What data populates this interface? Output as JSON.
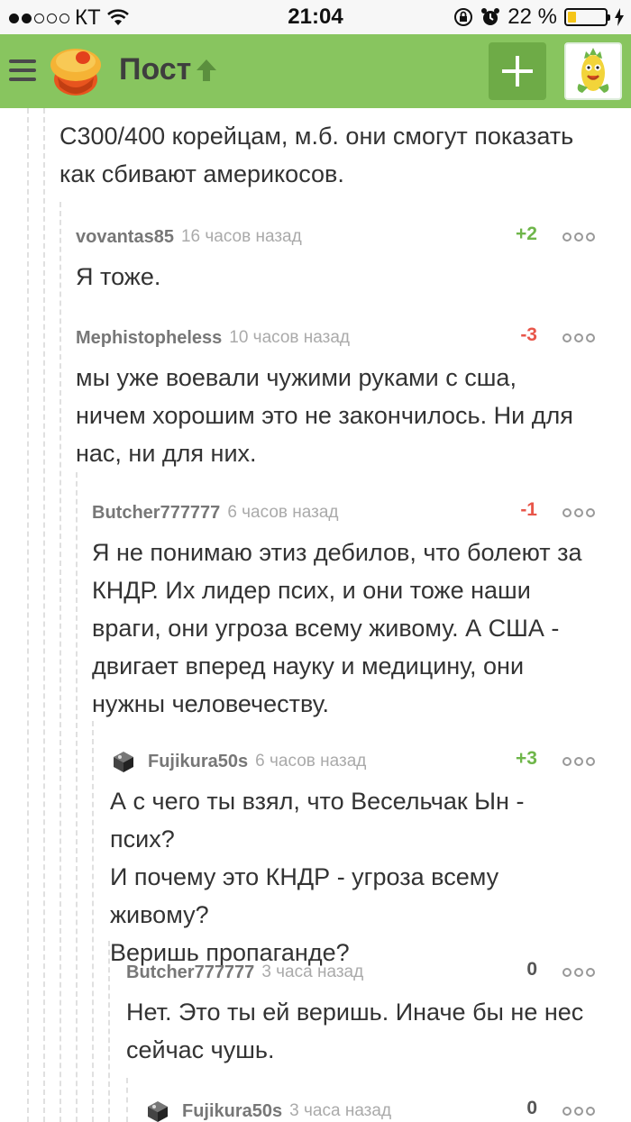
{
  "status_bar": {
    "carrier": "КТ",
    "time": "21:04",
    "battery_percent": "22 %",
    "battery_level": 0.22
  },
  "header": {
    "title": "Пост",
    "add_label": "+"
  },
  "top_text": {
    "line1": "С300/400 корейцам, м.б. они смогут показать",
    "line2": "как сбивают америкосов."
  },
  "comments": [
    {
      "author": "vovantas85",
      "time": "16 часов назад",
      "rating": "+2",
      "lines": [
        "Я тоже."
      ]
    },
    {
      "author": "Mephistopheless",
      "time": "10 часов назад",
      "rating": "-3",
      "lines": [
        "мы уже воевали чужими руками с сша,",
        "ничем хорошим это не закончилось. Ни для",
        "нас, ни для них."
      ]
    },
    {
      "author": "Butcher777777",
      "time": "6 часов назад",
      "rating": "-1",
      "lines": [
        "Я не понимаю этиз дебилов, что болеют за",
        "КНДР. Их лидер псих, и они тоже наши",
        "враги, они угроза всему живому. А США -",
        "двигает вперед науку и медицину, они",
        "нужны человечеству."
      ]
    },
    {
      "author": "Fujikura50s",
      "time": "6 часов назад",
      "rating": "+3",
      "lines": [
        "А с чего ты взял, что Весельчак Ын - псих?",
        "И почему это КНДР - угроза всему",
        "живому?",
        "Веришь пропаганде?"
      ]
    },
    {
      "author": "Butcher777777",
      "time": "3 часа назад",
      "rating": "0",
      "lines": [
        "Нет. Это ты ей веришь. Иначе бы не нес",
        "сейчас чушь."
      ]
    },
    {
      "author": "Fujikura50s",
      "time": "3 часа назад",
      "rating": "0",
      "lines": []
    }
  ]
}
